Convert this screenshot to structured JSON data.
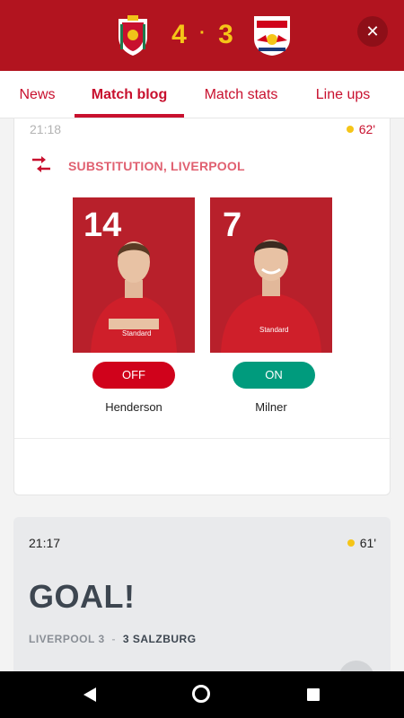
{
  "header": {
    "home_score": "4",
    "away_score": "3",
    "score_separator": "·",
    "home_crest_icon": "liverpool-crest-icon",
    "away_crest_icon": "salzburg-crest-icon",
    "close_icon": "close-icon"
  },
  "tabs": [
    {
      "label": "News",
      "active": false
    },
    {
      "label": "Match blog",
      "active": true
    },
    {
      "label": "Match stats",
      "active": false
    },
    {
      "label": "Line ups",
      "active": false
    }
  ],
  "substitution": {
    "time": "21:18",
    "minute": "62'",
    "title": "SUBSTITUTION, LIVERPOOL",
    "icon": "substitution-arrows-icon",
    "player_off": {
      "number": "14",
      "name": "Henderson",
      "badge": "OFF"
    },
    "player_on": {
      "number": "7",
      "name": "Milner",
      "badge": "ON"
    }
  },
  "goal_event": {
    "time": "21:17",
    "minute": "61'",
    "title": "GOAL!",
    "home_team": "LIVERPOOL",
    "home_score": "3",
    "separator": "-",
    "away_score": "3",
    "away_team": "SALZBURG"
  },
  "colors": {
    "brand_red": "#b2141f",
    "score_gold": "#f5c518",
    "off_red": "#d0021b",
    "on_green": "#009b7d"
  },
  "navbar": {
    "back_icon": "back-icon",
    "home_icon": "home-icon",
    "recent_icon": "recent-apps-icon"
  }
}
